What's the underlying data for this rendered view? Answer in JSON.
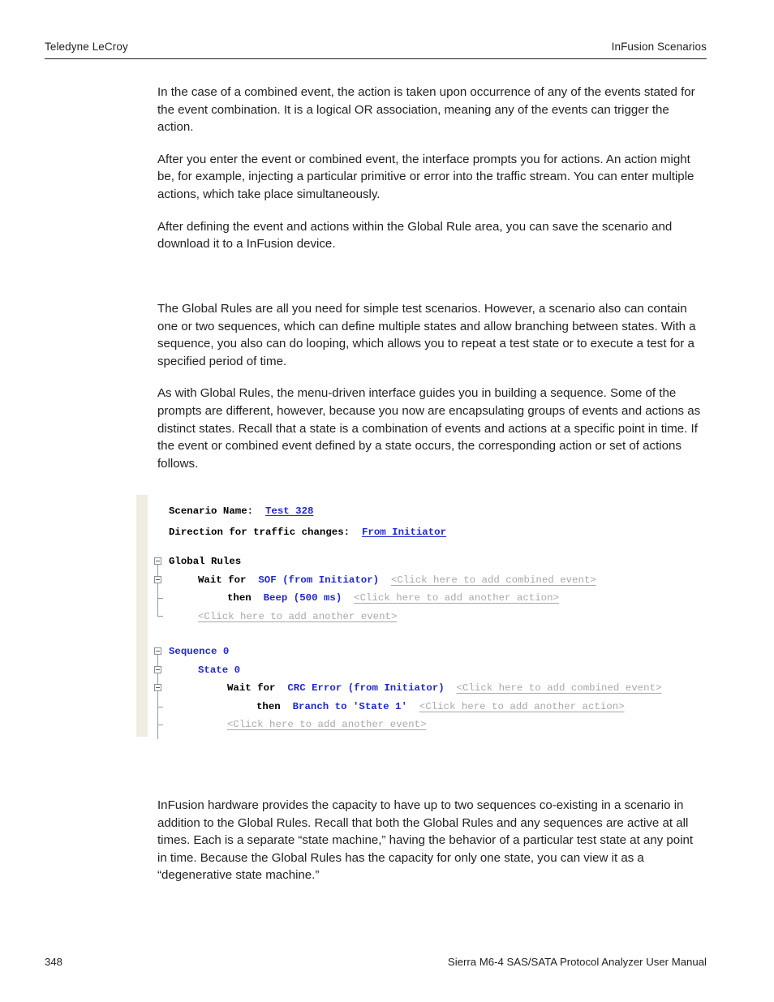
{
  "header": {
    "left": "Teledyne LeCroy",
    "right": "InFusion Scenarios"
  },
  "body": {
    "paragraphs_intro": [
      "In the case of a combined event, the action is taken upon occurrence of any of the events stated for the event combination. It is a logical OR association, meaning any of the events can trigger the action.",
      "After you enter the event or combined event, the interface prompts you for actions. An action might be, for example, injecting a particular primitive or error into the traffic stream. You can enter multiple actions, which take place simultaneously.",
      "After defining the event and actions within the Global Rule area, you can save the scenario and download it to a InFusion device."
    ],
    "paragraphs_sequence": [
      "The Global Rules are all you need for simple test scenarios. However, a scenario also can contain one or two sequences, which can define multiple states and allow branching between states. With a sequence, you also can do looping, which allows you to repeat a test state or to execute a test for a specified period of time.",
      "As with Global Rules, the menu-driven interface guides you in building a sequence. Some of the prompts are different, however, because you now are encapsulating groups of events and actions as distinct states. Recall that a state is a combination of events and actions at a specific point in time. If the event or combined event defined by a state occurs, the corresponding action or set of actions follows."
    ],
    "paragraphs_tail": [
      "InFusion hardware provides the capacity to have up to two sequences co-existing in a scenario in addition to the Global Rules. Recall that both the Global Rules and any sequences are active at all times. Each is a separate “state machine,” having the behavior of a particular test state at any point in time. Because the Global Rules has the capacity for only one state, you can view it as a “degenerative state machine.”"
    ]
  },
  "figure": {
    "scenario_name_label": "Scenario Name:",
    "scenario_name_value": "Test 328",
    "direction_label": "Direction for traffic changes:",
    "direction_value": "From Initiator",
    "global_rules_node": "Global Rules",
    "global_wait_prefix": "Wait for",
    "global_wait_event": "SOF (from Initiator)",
    "global_wait_placeholder": "<Click here to add combined event>",
    "global_then_prefix": "then",
    "global_then_action": "Beep (500 ms)",
    "global_then_placeholder": "<Click here to add another action>",
    "global_add_event_placeholder": "<Click here to add another event>",
    "sequence_node": "Sequence 0",
    "state_node": "State 0",
    "state_wait_prefix": "Wait for",
    "state_wait_event": "CRC Error (from Initiator)",
    "state_wait_placeholder": "<Click here to add combined event>",
    "state_then_prefix": "then",
    "state_then_action": "Branch to 'State 1'",
    "state_then_placeholder": "<Click here to add another action>",
    "state_add_event_placeholder": "<Click here to add another event>",
    "colors": {
      "link_blue": "#2128d0",
      "ghost_gray": "#a9a9a9",
      "gutter_beige": "#efece1",
      "connector_gray": "#9a9a9a"
    }
  },
  "footer": {
    "page_number": "348",
    "manual_title": "Sierra M6-4 SAS/SATA Protocol Analyzer User Manual"
  }
}
